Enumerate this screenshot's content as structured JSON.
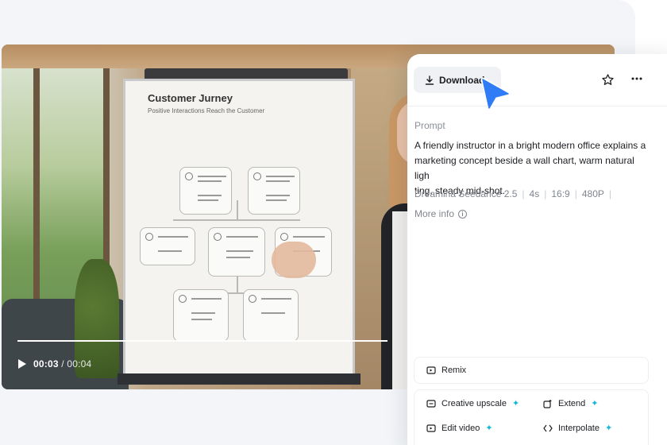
{
  "video": {
    "board_title": "Customer Jurney",
    "board_subtitle": "Positive Interactions Reach the Customer",
    "current_time": "00:03",
    "total_time": "/ 00:04",
    "progress": 0.75
  },
  "panel": {
    "download_label": "Download",
    "prompt_label": "Prompt",
    "prompt_text": "A friendly instructor in a bright modern office explains a\nmarketing concept beside a wall chart, warm natural ligh\nting, steady mid-shot.",
    "meta": [
      "Dreamina Seedance 2.5",
      "4s",
      "16:9",
      "480P"
    ],
    "more_info_label": "More info",
    "remix_label": "Remix",
    "tools": [
      {
        "label": "Creative upscale",
        "icon": "upscale-icon"
      },
      {
        "label": "Extend",
        "icon": "extend-icon"
      },
      {
        "label": "Edit video",
        "icon": "edit-video-icon"
      },
      {
        "label": "Interpolate",
        "icon": "interpolate-icon"
      }
    ]
  },
  "colors": {
    "accent_cursor": "#2f7cf6",
    "sparkle": "#14b8d4",
    "panel_bg": "#ffffff",
    "page_bg": "#f3f5f8"
  }
}
